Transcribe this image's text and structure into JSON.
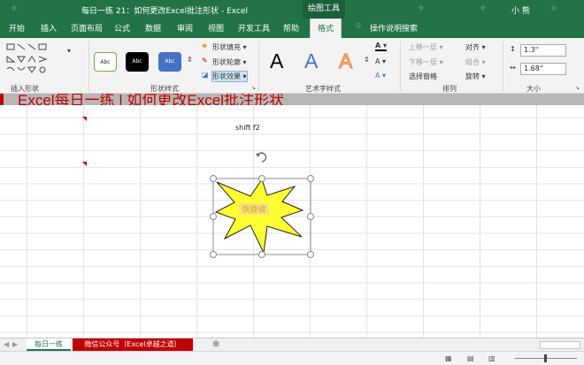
{
  "title": {
    "window_title": "每日一练 21：如何更改Excel批注形状  -  Excel",
    "context_tab": "绘图工具",
    "user": "小  熊"
  },
  "tabs": [
    {
      "label": "开始"
    },
    {
      "label": "插入"
    },
    {
      "label": "页面布局"
    },
    {
      "label": "公式"
    },
    {
      "label": "数据"
    },
    {
      "label": "审阅"
    },
    {
      "label": "视图"
    },
    {
      "label": "开发工具"
    },
    {
      "label": "帮助"
    },
    {
      "label": "格式",
      "active": true
    }
  ],
  "tell_me": "操作说明搜索",
  "ribbon": {
    "groups": {
      "insert_shapes": "插入形状",
      "shape_styles": "形状样式",
      "wordart_styles": "艺术字样式",
      "arrange": "排列",
      "size": "大小"
    },
    "style_buttons": [
      "Abc",
      "Abc",
      "Abc"
    ],
    "shape_fill": "形状填充 ▾",
    "shape_outline": "形状轮廓 ▾",
    "shape_effects": "形状效果 ▾",
    "wordart_letters": [
      "A",
      "A",
      "A"
    ],
    "bring_forward": "上移一层 ▾",
    "send_backward": "下移一层 ▾",
    "selection_pane": "选择窗格",
    "align": "对齐 ▾",
    "group": "组合 ▾",
    "rotate": "旋转 ▾",
    "height": "1.3\"",
    "width": "1.68\""
  },
  "sheet": {
    "banner_text": "Excel每日一练 | 如何更改Excel批注形状",
    "cell_note": "shift f2",
    "shape_text": "快捷键"
  },
  "sheet_tabs": [
    {
      "label": "每日一练",
      "active": true
    },
    {
      "label": "微信公众号（Excel卓越之道）"
    }
  ],
  "colors": {
    "excel_green": "#217346",
    "shape_fill": "#ffff33",
    "shape_text": "#d2a23c",
    "banner_text": "#c00000",
    "sheet_tab_red": "#c00000"
  }
}
